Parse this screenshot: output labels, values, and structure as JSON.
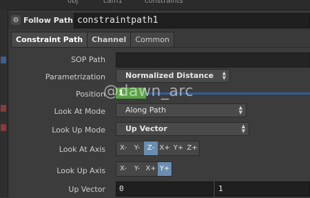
{
  "breadcrumb": [
    "obj",
    "cam1",
    "constraints"
  ],
  "node": {
    "type_label": "Follow Path",
    "name": "constraintpath1"
  },
  "tabs": [
    "Constraint Path",
    "Channel",
    "Common"
  ],
  "params": {
    "sop_path": {
      "label": "SOP Path",
      "value": ""
    },
    "parametrization": {
      "label": "Parametrization",
      "value": "Normalized Distance"
    },
    "position": {
      "label": "Position",
      "value": "1"
    },
    "look_at_mode": {
      "label": "Look At Mode",
      "value": "Along Path"
    },
    "look_up_mode": {
      "label": "Look Up Mode",
      "value": "Up Vector"
    },
    "look_at_axis": {
      "label": "Look At Axis",
      "options": [
        "X-",
        "Y-",
        "Z-",
        "X+",
        "Y+",
        "Z+"
      ],
      "selected": "Z-"
    },
    "look_up_axis": {
      "label": "Look Up Axis",
      "options": [
        "X-",
        "Y-",
        "X+",
        "Y+"
      ],
      "selected": "Y+"
    },
    "up_vector": {
      "label": "Up Vector",
      "values": [
        "0",
        "1"
      ]
    }
  },
  "watermark": "@dawn_arc"
}
